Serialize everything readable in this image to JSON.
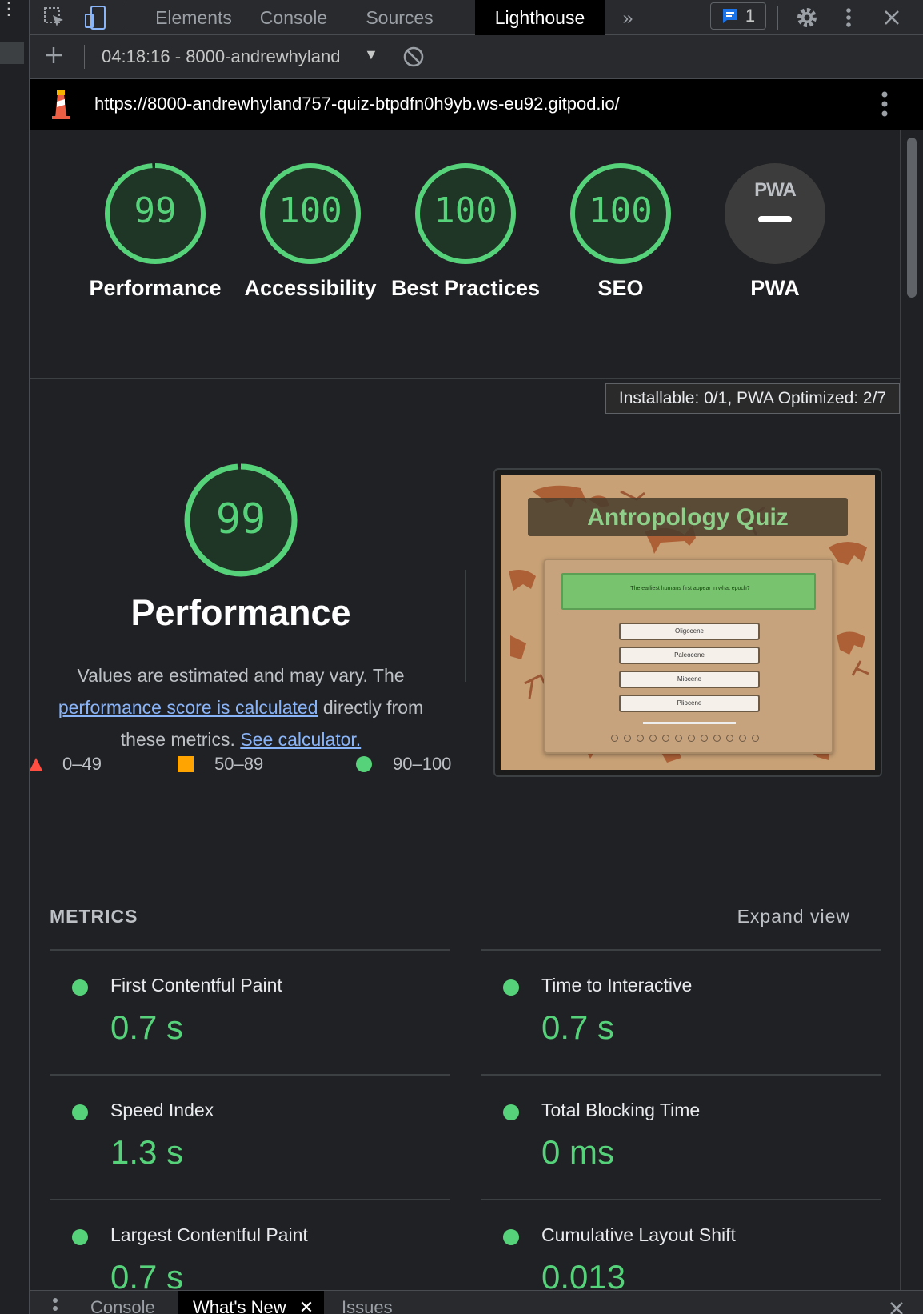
{
  "tabbar": {
    "tabs": [
      "Elements",
      "Console",
      "Sources",
      "Lighthouse"
    ],
    "active_tab": "Lighthouse",
    "more": "»",
    "message_count": "1"
  },
  "toolbar": {
    "run_label": "04:18:16 - 8000-andrewhyland",
    "caret": "▼"
  },
  "urlbar": {
    "url": "https://8000-andrewhyland757-quiz-btpdfn0h9yb.ws-eu92.gitpod.io/"
  },
  "categories": [
    {
      "score": "99",
      "score_value": 99,
      "label": "Performance"
    },
    {
      "score": "100",
      "score_value": 100,
      "label": "Accessibility"
    },
    {
      "score": "100",
      "score_value": 100,
      "label": "Best Practices"
    },
    {
      "score": "100",
      "score_value": 100,
      "label": "SEO"
    },
    {
      "score": "",
      "label": "PWA",
      "badge": "PWA"
    }
  ],
  "tooltip": "Installable: 0/1, PWA Optimized: 2/7",
  "performance": {
    "score": "99",
    "score_value": 99,
    "title": "Performance",
    "desc_1": "Values are estimated and may vary. The",
    "link_1": "performance score is calculated",
    "desc_2": "directly from",
    "desc_3": "these metrics.",
    "link_2": "See calculator.",
    "legend": [
      "0–49",
      "50–89",
      "90–100"
    ]
  },
  "screenshot": {
    "title": "Antropology Quiz",
    "question": "The earliest humans first appear in what epoch?",
    "answers": [
      "Oligocene",
      "Paleocene",
      "Miocene",
      "Pliocene"
    ]
  },
  "metrics": {
    "title": "METRICS",
    "expand": "Expand view",
    "items": [
      {
        "name": "First Contentful Paint",
        "value": "0.7 s"
      },
      {
        "name": "Time to Interactive",
        "value": "0.7 s"
      },
      {
        "name": "Speed Index",
        "value": "1.3 s"
      },
      {
        "name": "Total Blocking Time",
        "value": "0 ms"
      },
      {
        "name": "Largest Contentful Paint",
        "value": "0.7 s"
      },
      {
        "name": "Cumulative Layout Shift",
        "value": "0.013"
      }
    ]
  },
  "drawer": {
    "tabs": [
      "Console",
      "What's New",
      "Issues"
    ],
    "active_tab": "What's New"
  },
  "colors": {
    "pass": "#56d27a",
    "average": "#ffa400",
    "fail": "#ff4e42",
    "link": "#8ab4f8"
  }
}
